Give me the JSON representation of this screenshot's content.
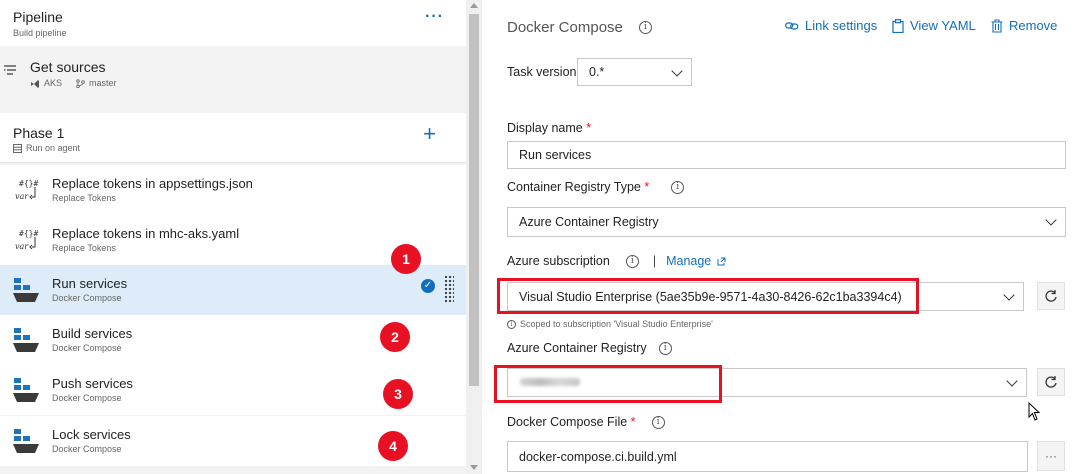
{
  "pipeline": {
    "title": "Pipeline",
    "subtitle": "Build pipeline",
    "more": "···"
  },
  "sources": {
    "title": "Get sources",
    "repo": "AKS",
    "branch": "master"
  },
  "phase": {
    "title": "Phase 1",
    "subtitle": "Run on agent",
    "add": "+"
  },
  "tasks": [
    {
      "title": "Replace tokens in appsettings.json",
      "subtitle": "Replace Tokens"
    },
    {
      "title": "Replace tokens in mhc-aks.yaml",
      "subtitle": "Replace Tokens"
    },
    {
      "title": "Run services",
      "subtitle": "Docker Compose"
    },
    {
      "title": "Build services",
      "subtitle": "Docker Compose"
    },
    {
      "title": "Push services",
      "subtitle": "Docker Compose"
    },
    {
      "title": "Lock services",
      "subtitle": "Docker Compose"
    }
  ],
  "badges": [
    "1",
    "2",
    "3",
    "4"
  ],
  "detail": {
    "title": "Docker Compose",
    "link_settings": "Link settings",
    "view_yaml": "View YAML",
    "remove": "Remove",
    "task_version_label": "Task version",
    "task_version": "0.*",
    "display_name_label": "Display name",
    "display_name": "Run services",
    "registry_type_label": "Container Registry Type",
    "registry_type": "Azure Container Registry",
    "subscription_label": "Azure subscription",
    "manage": "Manage",
    "subscription": "Visual Studio Enterprise (5ae35b9e-9571-4a30-8426-62c1ba3394c4)",
    "scope_note": "Scoped to subscription 'Visual Studio Enterprise'",
    "acr_label": "Azure Container Registry",
    "compose_file_label": "Docker Compose File",
    "compose_file": "docker-compose.ci.build.yml",
    "more_button": "···",
    "required_mark": "*",
    "info_glyph": "i"
  },
  "colors": {
    "accent": "#106ebe",
    "highlight_red": "#e81123",
    "selected_row": "#deecf9"
  }
}
